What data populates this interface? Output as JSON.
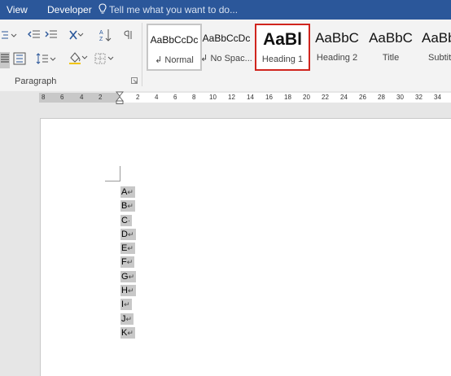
{
  "tabs": {
    "view": "View",
    "developer": "Developer"
  },
  "tell_me": {
    "text": "Tell me what you want to do..."
  },
  "paragraph_group": {
    "label": "Paragraph"
  },
  "styles": [
    {
      "preview": "AaBbCcDc",
      "name": "Normal",
      "marker": "↲"
    },
    {
      "preview": "AaBbCcDc",
      "name": "No Spac...",
      "marker": "↲"
    },
    {
      "preview": "AaBl",
      "name": "Heading 1",
      "marker": ""
    },
    {
      "preview": "AaBbC",
      "name": "Heading 2",
      "marker": ""
    },
    {
      "preview": "AaBbC",
      "name": "Title",
      "marker": ""
    },
    {
      "preview": "AaBbC",
      "name": "Subtit",
      "marker": ""
    }
  ],
  "ruler": {
    "ticks": [
      "8",
      "6",
      "4",
      "2",
      "2",
      "4",
      "6",
      "8",
      "10",
      "12",
      "14",
      "16",
      "18",
      "20",
      "22",
      "24",
      "26",
      "28",
      "30",
      "32",
      "34"
    ]
  },
  "document": {
    "lines": [
      {
        "text": "A",
        "mark": "↵"
      },
      {
        "text": "B",
        "mark": "↵"
      },
      {
        "text": "C",
        "mark": "·"
      },
      {
        "text": "D",
        "mark": "↵"
      },
      {
        "text": "E",
        "mark": "↵"
      },
      {
        "text": "F",
        "mark": "↵"
      },
      {
        "text": "G",
        "mark": "↵"
      },
      {
        "text": "H",
        "mark": "↵"
      },
      {
        "text": "I",
        "mark": "↵"
      },
      {
        "text": "J",
        "mark": "↵"
      },
      {
        "text": "K",
        "mark": "↵"
      }
    ]
  },
  "colors": {
    "ribbon_tab_bg": "#2b579a",
    "selected_style_border": "#d0251e",
    "selection_highlight": "#c8c8c8"
  }
}
